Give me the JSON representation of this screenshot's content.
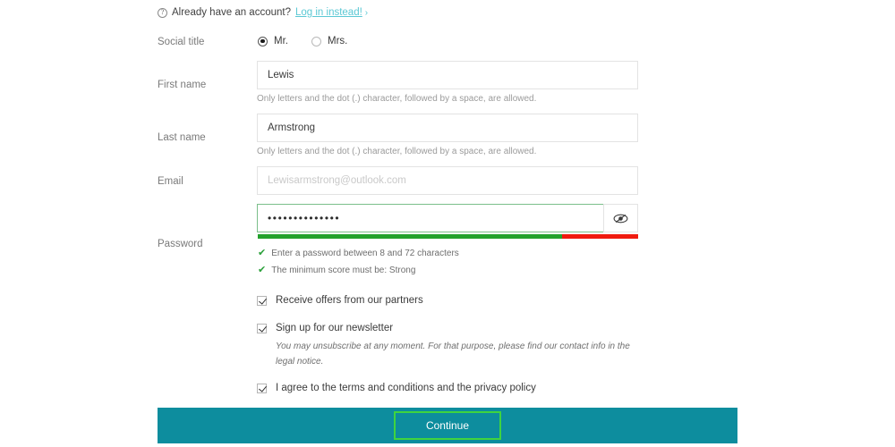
{
  "account_notice": {
    "icon": "question-circle-icon",
    "text": "Already have an account?",
    "link_label": "Log in instead!",
    "link_caret": "›",
    "link_color": "#5bc8d4"
  },
  "social_title": {
    "label": "Social title",
    "options": [
      {
        "label": "Mr.",
        "selected": true
      },
      {
        "label": "Mrs.",
        "selected": false
      }
    ]
  },
  "first_name": {
    "label": "First name",
    "value": "Lewis",
    "placeholder": "",
    "hint": "Only letters and the dot (.) character, followed by a space, are allowed."
  },
  "last_name": {
    "label": "Last name",
    "value": "Armstrong",
    "placeholder": "",
    "hint": "Only letters and the dot (.) character, followed by a space, are allowed."
  },
  "email": {
    "label": "Email",
    "value": "",
    "placeholder": "Lewisarmstrong@outlook.com"
  },
  "password": {
    "label": "Password",
    "value": "••••••••••••••",
    "toggle_icon": "eye-slash-icon",
    "strength": {
      "filled_percent": 80,
      "remaining_percent": 20,
      "filled_color": "#23a12c",
      "remaining_color": "#f01a0e"
    },
    "requirements": [
      {
        "mark": "✔",
        "text": "Enter a password between 8 and 72 characters"
      },
      {
        "mark": "✔",
        "text": "The minimum score must be: Strong"
      }
    ]
  },
  "checkboxes": [
    {
      "label": "Receive offers from our partners",
      "checked": true,
      "sub": ""
    },
    {
      "label": "Sign up for our newsletter",
      "checked": true,
      "sub": "You may unsubscribe at any moment. For that purpose, please find our contact info in the legal notice."
    },
    {
      "label": "I agree to the terms and conditions and the privacy policy",
      "checked": true,
      "sub": ""
    }
  ],
  "footer": {
    "continue_label": "Continue",
    "bar_color": "#0d8d9e",
    "button_focus_color": "#3fd43f"
  }
}
